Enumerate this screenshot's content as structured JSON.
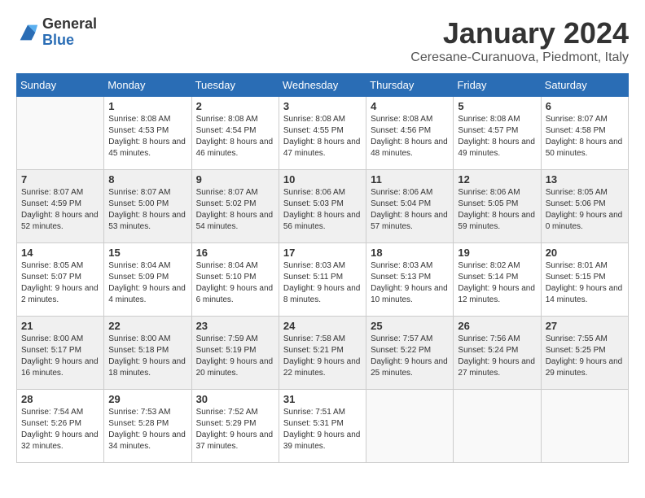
{
  "logo": {
    "general": "General",
    "blue": "Blue"
  },
  "title": "January 2024",
  "subtitle": "Ceresane-Curanuova, Piedmont, Italy",
  "weekdays": [
    "Sunday",
    "Monday",
    "Tuesday",
    "Wednesday",
    "Thursday",
    "Friday",
    "Saturday"
  ],
  "weeks": [
    [
      {
        "day": "",
        "sunrise": "",
        "sunset": "",
        "daylight": "",
        "empty": true
      },
      {
        "day": "1",
        "sunrise": "Sunrise: 8:08 AM",
        "sunset": "Sunset: 4:53 PM",
        "daylight": "Daylight: 8 hours and 45 minutes."
      },
      {
        "day": "2",
        "sunrise": "Sunrise: 8:08 AM",
        "sunset": "Sunset: 4:54 PM",
        "daylight": "Daylight: 8 hours and 46 minutes."
      },
      {
        "day": "3",
        "sunrise": "Sunrise: 8:08 AM",
        "sunset": "Sunset: 4:55 PM",
        "daylight": "Daylight: 8 hours and 47 minutes."
      },
      {
        "day": "4",
        "sunrise": "Sunrise: 8:08 AM",
        "sunset": "Sunset: 4:56 PM",
        "daylight": "Daylight: 8 hours and 48 minutes."
      },
      {
        "day": "5",
        "sunrise": "Sunrise: 8:08 AM",
        "sunset": "Sunset: 4:57 PM",
        "daylight": "Daylight: 8 hours and 49 minutes."
      },
      {
        "day": "6",
        "sunrise": "Sunrise: 8:07 AM",
        "sunset": "Sunset: 4:58 PM",
        "daylight": "Daylight: 8 hours and 50 minutes."
      }
    ],
    [
      {
        "day": "7",
        "sunrise": "Sunrise: 8:07 AM",
        "sunset": "Sunset: 4:59 PM",
        "daylight": "Daylight: 8 hours and 52 minutes."
      },
      {
        "day": "8",
        "sunrise": "Sunrise: 8:07 AM",
        "sunset": "Sunset: 5:00 PM",
        "daylight": "Daylight: 8 hours and 53 minutes."
      },
      {
        "day": "9",
        "sunrise": "Sunrise: 8:07 AM",
        "sunset": "Sunset: 5:02 PM",
        "daylight": "Daylight: 8 hours and 54 minutes."
      },
      {
        "day": "10",
        "sunrise": "Sunrise: 8:06 AM",
        "sunset": "Sunset: 5:03 PM",
        "daylight": "Daylight: 8 hours and 56 minutes."
      },
      {
        "day": "11",
        "sunrise": "Sunrise: 8:06 AM",
        "sunset": "Sunset: 5:04 PM",
        "daylight": "Daylight: 8 hours and 57 minutes."
      },
      {
        "day": "12",
        "sunrise": "Sunrise: 8:06 AM",
        "sunset": "Sunset: 5:05 PM",
        "daylight": "Daylight: 8 hours and 59 minutes."
      },
      {
        "day": "13",
        "sunrise": "Sunrise: 8:05 AM",
        "sunset": "Sunset: 5:06 PM",
        "daylight": "Daylight: 9 hours and 0 minutes."
      }
    ],
    [
      {
        "day": "14",
        "sunrise": "Sunrise: 8:05 AM",
        "sunset": "Sunset: 5:07 PM",
        "daylight": "Daylight: 9 hours and 2 minutes."
      },
      {
        "day": "15",
        "sunrise": "Sunrise: 8:04 AM",
        "sunset": "Sunset: 5:09 PM",
        "daylight": "Daylight: 9 hours and 4 minutes."
      },
      {
        "day": "16",
        "sunrise": "Sunrise: 8:04 AM",
        "sunset": "Sunset: 5:10 PM",
        "daylight": "Daylight: 9 hours and 6 minutes."
      },
      {
        "day": "17",
        "sunrise": "Sunrise: 8:03 AM",
        "sunset": "Sunset: 5:11 PM",
        "daylight": "Daylight: 9 hours and 8 minutes."
      },
      {
        "day": "18",
        "sunrise": "Sunrise: 8:03 AM",
        "sunset": "Sunset: 5:13 PM",
        "daylight": "Daylight: 9 hours and 10 minutes."
      },
      {
        "day": "19",
        "sunrise": "Sunrise: 8:02 AM",
        "sunset": "Sunset: 5:14 PM",
        "daylight": "Daylight: 9 hours and 12 minutes."
      },
      {
        "day": "20",
        "sunrise": "Sunrise: 8:01 AM",
        "sunset": "Sunset: 5:15 PM",
        "daylight": "Daylight: 9 hours and 14 minutes."
      }
    ],
    [
      {
        "day": "21",
        "sunrise": "Sunrise: 8:00 AM",
        "sunset": "Sunset: 5:17 PM",
        "daylight": "Daylight: 9 hours and 16 minutes."
      },
      {
        "day": "22",
        "sunrise": "Sunrise: 8:00 AM",
        "sunset": "Sunset: 5:18 PM",
        "daylight": "Daylight: 9 hours and 18 minutes."
      },
      {
        "day": "23",
        "sunrise": "Sunrise: 7:59 AM",
        "sunset": "Sunset: 5:19 PM",
        "daylight": "Daylight: 9 hours and 20 minutes."
      },
      {
        "day": "24",
        "sunrise": "Sunrise: 7:58 AM",
        "sunset": "Sunset: 5:21 PM",
        "daylight": "Daylight: 9 hours and 22 minutes."
      },
      {
        "day": "25",
        "sunrise": "Sunrise: 7:57 AM",
        "sunset": "Sunset: 5:22 PM",
        "daylight": "Daylight: 9 hours and 25 minutes."
      },
      {
        "day": "26",
        "sunrise": "Sunrise: 7:56 AM",
        "sunset": "Sunset: 5:24 PM",
        "daylight": "Daylight: 9 hours and 27 minutes."
      },
      {
        "day": "27",
        "sunrise": "Sunrise: 7:55 AM",
        "sunset": "Sunset: 5:25 PM",
        "daylight": "Daylight: 9 hours and 29 minutes."
      }
    ],
    [
      {
        "day": "28",
        "sunrise": "Sunrise: 7:54 AM",
        "sunset": "Sunset: 5:26 PM",
        "daylight": "Daylight: 9 hours and 32 minutes."
      },
      {
        "day": "29",
        "sunrise": "Sunrise: 7:53 AM",
        "sunset": "Sunset: 5:28 PM",
        "daylight": "Daylight: 9 hours and 34 minutes."
      },
      {
        "day": "30",
        "sunrise": "Sunrise: 7:52 AM",
        "sunset": "Sunset: 5:29 PM",
        "daylight": "Daylight: 9 hours and 37 minutes."
      },
      {
        "day": "31",
        "sunrise": "Sunrise: 7:51 AM",
        "sunset": "Sunset: 5:31 PM",
        "daylight": "Daylight: 9 hours and 39 minutes."
      },
      {
        "day": "",
        "sunrise": "",
        "sunset": "",
        "daylight": "",
        "empty": true
      },
      {
        "day": "",
        "sunrise": "",
        "sunset": "",
        "daylight": "",
        "empty": true
      },
      {
        "day": "",
        "sunrise": "",
        "sunset": "",
        "daylight": "",
        "empty": true
      }
    ]
  ]
}
